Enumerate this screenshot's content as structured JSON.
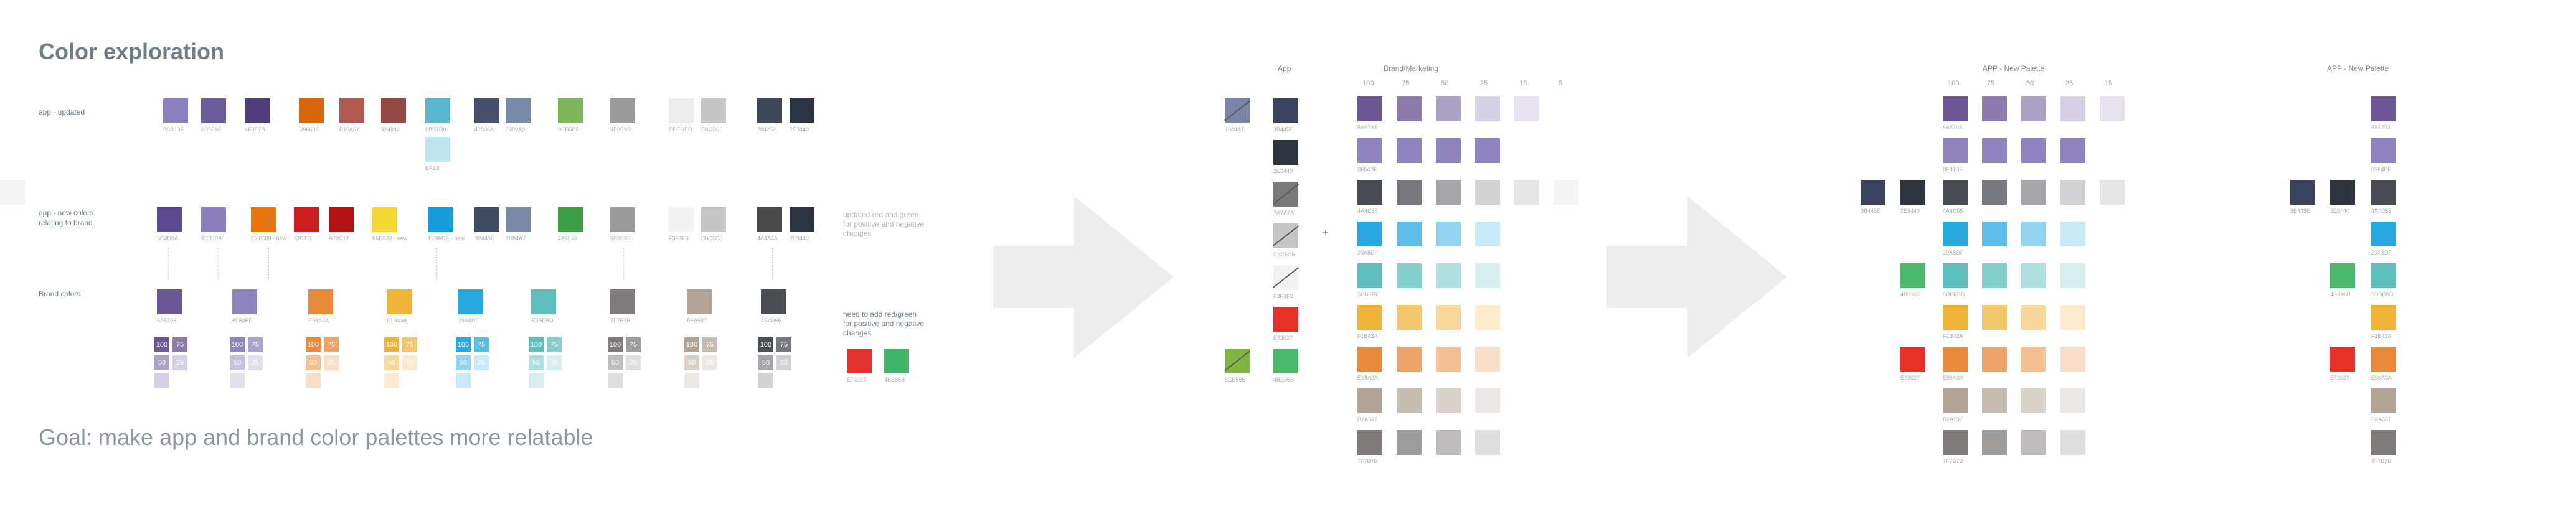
{
  "header": {
    "title": "Color exploration"
  },
  "footer": {
    "goal": "Goal: make app and brand color palettes more relatable"
  },
  "rows": {
    "app_updated": "app - updated",
    "app_new": "app - new colors\nrelating to brand",
    "brand": "Brand colors"
  },
  "notes": {
    "updated": "updated red and green\nfor positive and negative\nchanges",
    "need": "need to add red/green\nfor positive and negative\nchanges"
  },
  "palette_headers": {
    "app": "App",
    "brand_marketing": "Brand/Marketing",
    "new_palette_1": "APP - New Palette",
    "new_palette_2": "APP - New Palette"
  },
  "ticks_6": [
    "100",
    "75",
    "50",
    "25",
    "15",
    "5"
  ],
  "ticks_5": [
    "100",
    "75",
    "50",
    "25",
    "15"
  ],
  "app_updated_colors": [
    {
      "hex": "#8c80bf",
      "label": "8C80BF"
    },
    {
      "hex": "#6b5b9a",
      "label": "6B5B9F"
    },
    {
      "hex": "#4f3e7b",
      "label": "4F3E7B"
    },
    {
      "hex": "#d9660f",
      "label": "D9660F"
    },
    {
      "hex": "#b15a52",
      "label": "B15A52"
    },
    {
      "hex": "#924942",
      "label": "924942"
    },
    {
      "hex": "#5bb7d0",
      "label": "6BB7D0"
    },
    {
      "hex": "#47506a",
      "label": "47506A"
    },
    {
      "hex": "#7989a8",
      "label": "7989A8"
    },
    {
      "hex": "#7fb55b",
      "label": "8CB5B8"
    },
    {
      "hex": "#9b9b9b",
      "label": "9B9B9B"
    },
    {
      "hex": "#ececec",
      "label": "EDEDED"
    },
    {
      "hex": "#c6c5c5",
      "label": "C6C5C5"
    },
    {
      "hex": "#3f4656",
      "label": "384252"
    },
    {
      "hex": "#2b3442",
      "label": "2E3440"
    }
  ],
  "app_updated_extra": {
    "hex": "#bfe3ef",
    "label": "BFE3"
  },
  "app_new_colors": [
    {
      "hex": "#5c4a8f",
      "label": "5C4D8A"
    },
    {
      "hex": "#8b80bd",
      "label": "8C80BA"
    },
    {
      "hex": "#e57511",
      "label": "E77C09 - new"
    },
    {
      "hex": "#cf1e1e",
      "label": "C91111"
    },
    {
      "hex": "#b11212",
      "label": "A70C17"
    },
    {
      "hex": "#f3d533",
      "label": "F6D533 - new"
    },
    {
      "hex": "#179bd8",
      "label": "1E9ADE - new"
    },
    {
      "hex": "#3f4a63",
      "label": "3B445E"
    },
    {
      "hex": "#7b88a6",
      "label": "7B84A7"
    },
    {
      "hex": "#3e9e46",
      "label": "429E46"
    },
    {
      "hex": "#9b9b9b",
      "label": "9B9B9B"
    },
    {
      "hex": "#f3f3f3",
      "label": "F3F3F3"
    },
    {
      "hex": "#c6c5c5",
      "label": "C6C5C5"
    },
    {
      "hex": "#4a4a4a",
      "label": "4A4A4A"
    },
    {
      "hex": "#2b3442",
      "label": "2E3440"
    }
  ],
  "brand_colors": [
    {
      "hex": "#6a5793",
      "t75": "#8b7cab",
      "t50": "#aba2c6",
      "t25": "#d6d1e4",
      "label": "6A5793"
    },
    {
      "hex": "#8f84bf",
      "t75": "#aba3cf",
      "t50": "#c6c0df",
      "t25": "#e2dfef",
      "label": "8F84BF"
    },
    {
      "hex": "#e98a3a",
      "t75": "#eda36a",
      "t50": "#f3c093",
      "t25": "#f9dfc8",
      "label": "E98A3A"
    },
    {
      "hex": "#f1b43a",
      "t75": "#f3c66a",
      "t50": "#f7d89a",
      "t25": "#fbebcc",
      "label": "F1B43A"
    },
    {
      "hex": "#29a8df",
      "t75": "#5ebde7",
      "t50": "#93d3ef",
      "t25": "#c9e9f7",
      "label": "29A8DF"
    },
    {
      "hex": "#5dbfbd",
      "t75": "#85cfcd",
      "t50": "#aedfde",
      "t25": "#d6efee",
      "label": "5DBFBD"
    },
    {
      "hex": "#7f7b7b",
      "t75": "#9f9c9c",
      "t50": "#bfbdbd",
      "t25": "#dfdede",
      "label": "7F7B7B"
    },
    {
      "hex": "#b2a597",
      "t75": "#c5bbb1",
      "t50": "#d8d2cb",
      "t25": "#ece8e5",
      "label": "B2A597"
    },
    {
      "hex": "#4b4d55",
      "t75": "#78797f",
      "t50": "#a5a6aa",
      "t25": "#d2d2d4",
      "label": "4B4D55"
    }
  ],
  "mini_labels": [
    "100",
    "75",
    "50",
    "25"
  ],
  "need_colors": [
    {
      "hex": "#e0322f",
      "label": "E73027"
    },
    {
      "hex": "#42b36a",
      "label": "4BB96B"
    }
  ],
  "app_column": [
    {
      "hex": "#7a84a7",
      "label": "7984A7",
      "struck": true
    },
    {
      "hex": "#3b445e",
      "label": "3B445E"
    },
    {
      "hex": "#2e3440",
      "label": "2E3440"
    },
    {
      "hex": "#7a7a7a",
      "label": "7A7A7A",
      "struck": true
    },
    {
      "hex": "#c6c5c5",
      "label": "C6C5C5",
      "struck": true
    },
    {
      "hex": "#f3f3f3",
      "label": "F3F3F3",
      "struck": true
    },
    {
      "hex": "#e73027",
      "label": "E73027"
    },
    {
      "hex": "#7fb542",
      "label": "8CB55B",
      "struck": true
    },
    {
      "hex": "#4bb96b",
      "label": "4BB96B"
    }
  ],
  "brand_grid": [
    {
      "label": "6A5793",
      "cells": [
        "#6a5793",
        "#8b7cab",
        "#aba2c6",
        "#d6d1e4",
        "#e6e2ef"
      ]
    },
    {
      "label": "8F84BF",
      "cells": [
        "#8f84bf",
        "#8f84bf",
        "#8f84bf",
        "#8f84bf"
      ]
    },
    {
      "label": "4A4C55",
      "cells": [
        "#4a4c55",
        "#78797f",
        "#a5a6aa",
        "#d2d2d4",
        "#e6e6e7",
        "#f4f4f5"
      ]
    },
    {
      "label": "29A8DF",
      "cells": [
        "#29a8df",
        "#5ebde7",
        "#93d3ef",
        "#c9e9f7"
      ]
    },
    {
      "label": "5DBFBD",
      "cells": [
        "#5dbfbd",
        "#85cfcd",
        "#aedfde",
        "#d6efee"
      ]
    },
    {
      "label": "F1B43A",
      "cells": [
        "#f1b43a",
        "#f3c66a",
        "#f7d89a",
        "#fbebcc"
      ]
    },
    {
      "label": "E98A3A",
      "cells": [
        "#e98a3a",
        "#eda36a",
        "#f3c093",
        "#f9dfc8"
      ]
    },
    {
      "label": "B2A597",
      "cells": [
        "#b2a597",
        "#c5bbb1",
        "#d8d2cb",
        "#ece8e5"
      ]
    },
    {
      "label": "7F7B7B",
      "cells": [
        "#7f7b7b",
        "#9f9c9c",
        "#bfbdbd",
        "#dfdede"
      ]
    }
  ],
  "new_grid": [
    {
      "label": "6A5793",
      "cells": [
        "#6a5793",
        "#8b7cab",
        "#aba2c6",
        "#d6d1e4",
        "#e6e2ef"
      ]
    },
    {
      "label": "8F84BF",
      "cells": [
        "#8f84bf",
        "#8f84bf",
        "#8f84bf",
        "#8f84bf"
      ]
    },
    {
      "label": "4A4C55",
      "cells": [
        "#4a4c55",
        "#78797f",
        "#a5a6aa",
        "#d2d2d4",
        "#e6e6e7",
        "#f4f4f5"
      ],
      "pre": [
        {
          "hex": "#3b445e",
          "label": "3B445E"
        },
        {
          "hex": "#2e3440",
          "label": "2E3440"
        }
      ]
    },
    {
      "label": "29A8DF",
      "cells": [
        "#29a8df",
        "#5ebde7",
        "#93d3ef",
        "#c9e9f7"
      ]
    },
    {
      "label": "5DBFBD",
      "cells": [
        "#5dbfbd",
        "#85cfcd",
        "#aedfde",
        "#d6efee"
      ],
      "pre": [
        {
          "hex": "#4bb96b",
          "label": "4BB96B"
        }
      ]
    },
    {
      "label": "F1B43A",
      "cells": [
        "#f1b43a",
        "#f3c66a",
        "#f7d89a",
        "#fbebcc"
      ]
    },
    {
      "label": "E98A3A",
      "cells": [
        "#e98a3a",
        "#eda36a",
        "#f3c093",
        "#f9dfc8"
      ],
      "pre": [
        {
          "hex": "#e73027",
          "label": "E73027"
        }
      ]
    },
    {
      "label": "B2A597",
      "cells": [
        "#b2a597",
        "#c5bbb1",
        "#d8d2cb",
        "#ece8e5"
      ]
    },
    {
      "label": "7F7B7B",
      "cells": [
        "#7f7b7b",
        "#9f9c9c",
        "#bfbdbd",
        "#dfdede"
      ]
    }
  ],
  "final_column": [
    {
      "hex": "#6a5793",
      "label": "6A5793"
    },
    {
      "hex": "#8f84bf",
      "label": "8F84BF"
    },
    {
      "hex": "#4a4c55",
      "label": "4A4C55",
      "pre": [
        {
          "hex": "#3b445e",
          "label": "3B445E"
        },
        {
          "hex": "#2e3440",
          "label": "2E3440"
        }
      ]
    },
    {
      "hex": "#29a8df",
      "label": "29A8DF"
    },
    {
      "hex": "#5dbfbd",
      "label": "5DBFBD",
      "pre": [
        {
          "hex": "#4bb96b",
          "label": "4BB96B"
        }
      ]
    },
    {
      "hex": "#f1b43a",
      "label": "F1B43A"
    },
    {
      "hex": "#e98a3a",
      "label": "E98A3A",
      "pre": [
        {
          "hex": "#e73027",
          "label": "E73027"
        }
      ]
    },
    {
      "hex": "#b2a597",
      "label": "B2A597"
    },
    {
      "hex": "#7f7b7b",
      "label": "7F7B7B"
    }
  ],
  "arrow_color": "#ededed"
}
